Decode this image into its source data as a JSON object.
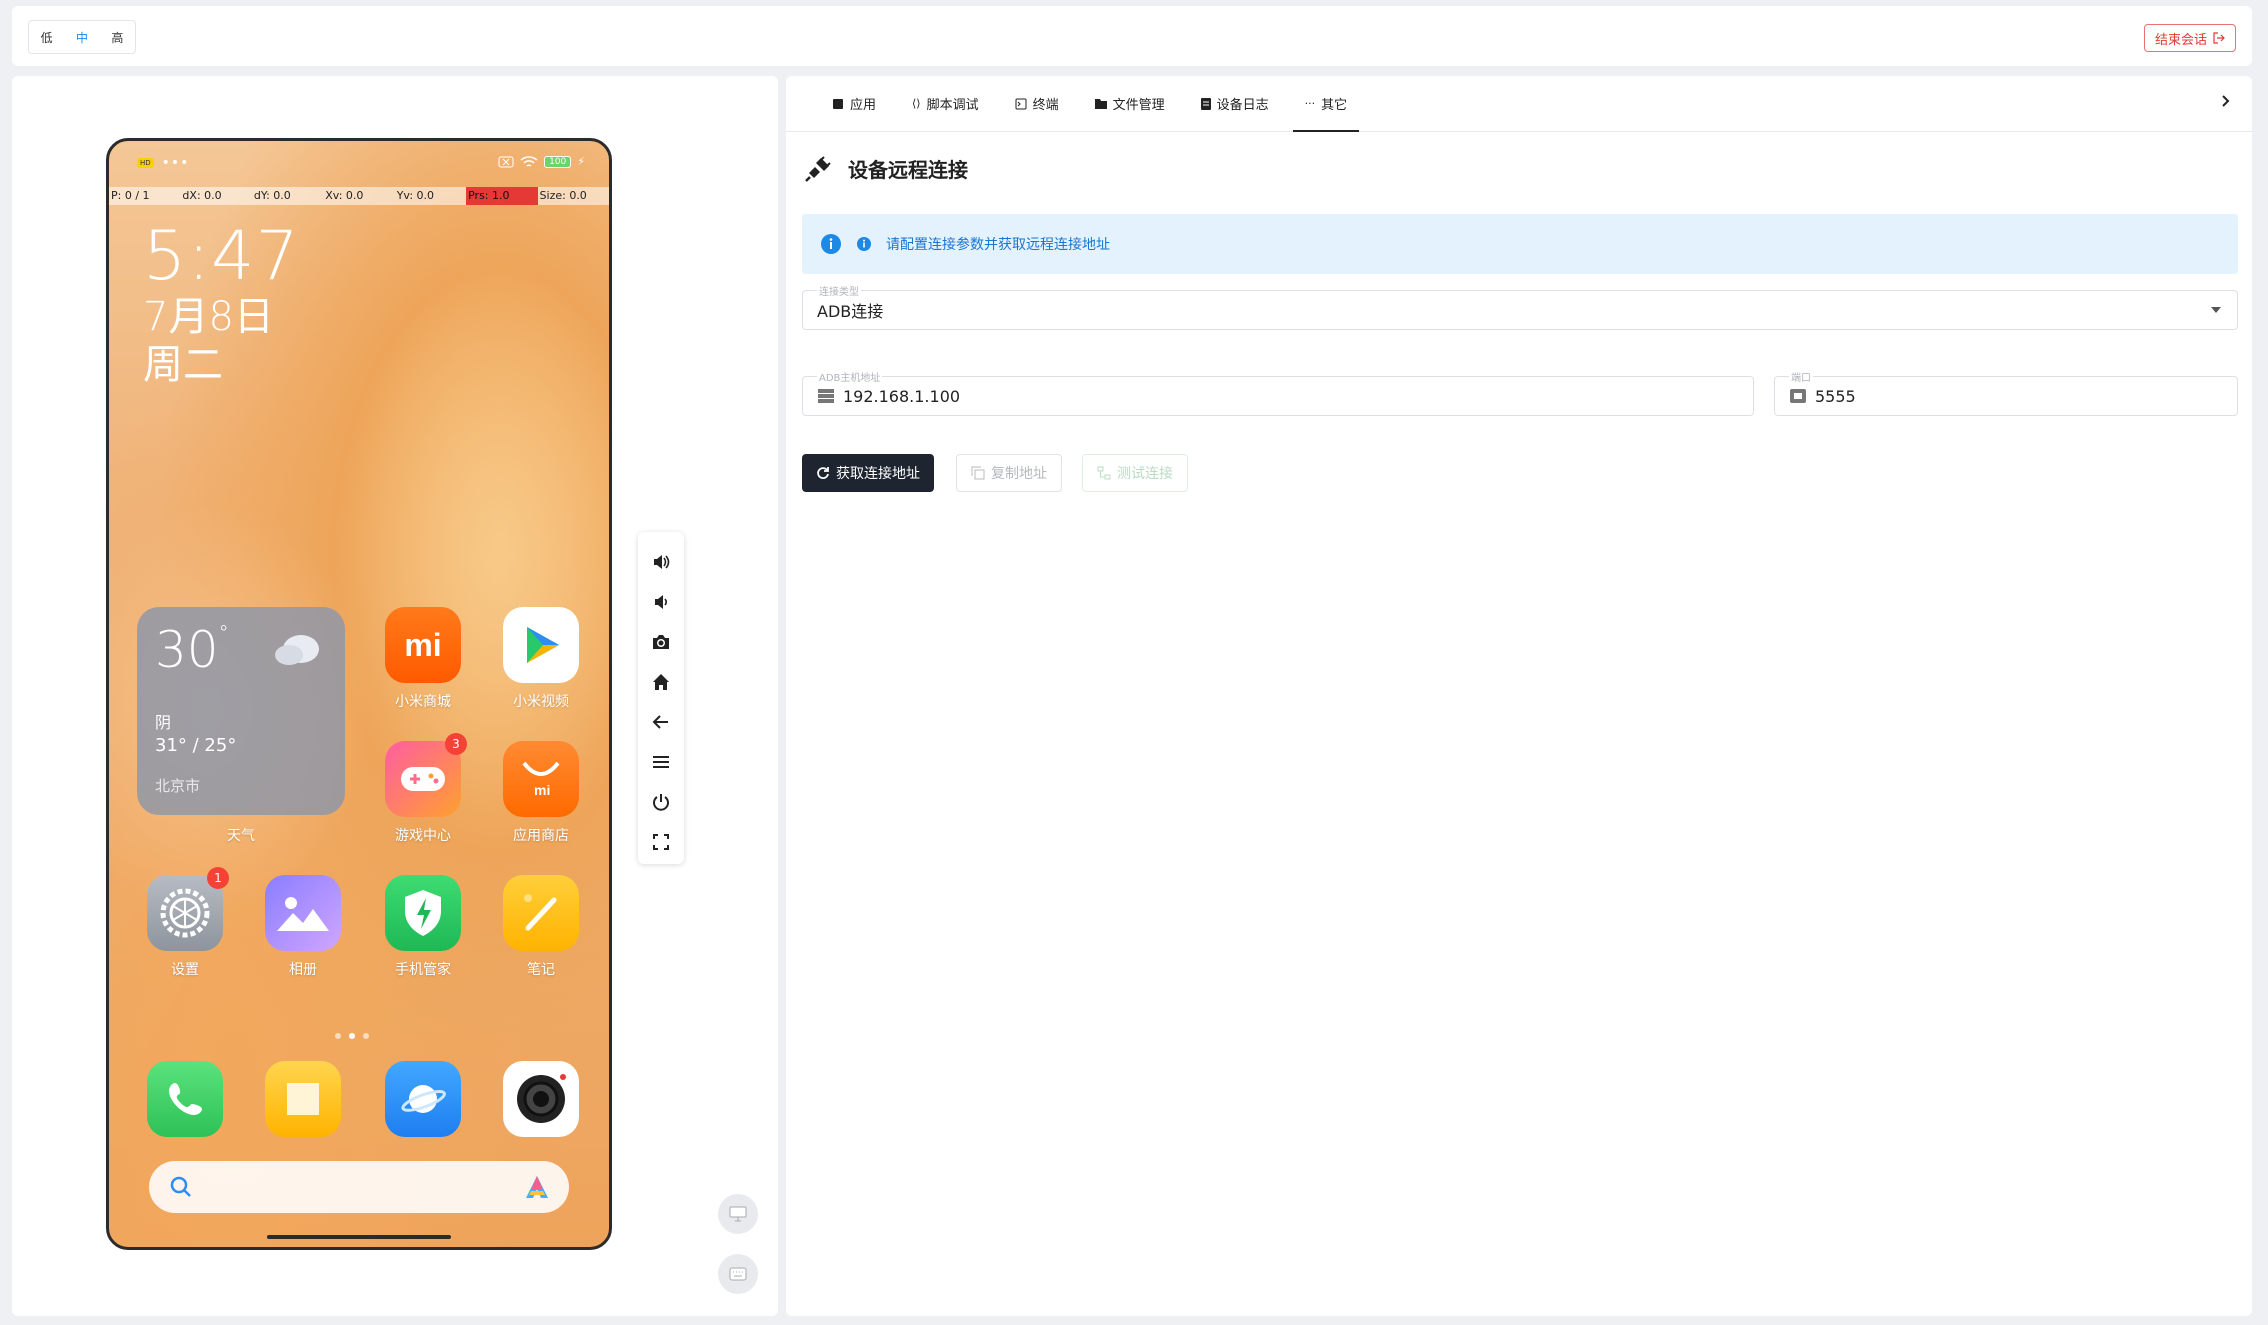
{
  "topbar": {
    "quality_options": [
      "低",
      "中",
      "高"
    ],
    "quality_selected": "中",
    "end_session_label": "结束会话"
  },
  "device": {
    "status_badge": "HD",
    "battery": "100",
    "pointer": {
      "p": "P: 0 / 1",
      "dx": "dX: 0.0",
      "dy": "dY: 0.0",
      "xv": "Xv: 0.0",
      "yv": "Yv: 0.0",
      "prs": "Prs: 1.0",
      "size": "Size: 0.0"
    },
    "clock": {
      "time": "5:47",
      "date": "7月8日",
      "weekday": "周二"
    },
    "weather": {
      "temp": "30",
      "degree": "°",
      "condition": "阴",
      "range": "31° / 25°",
      "city": "北京市",
      "label": "天气"
    },
    "apps": [
      {
        "label": "小米商城",
        "icon": "mi-store-icon"
      },
      {
        "label": "小米视频",
        "icon": "mi-video-icon"
      },
      {
        "label": "游戏中心",
        "icon": "game-center-icon",
        "badge": "3"
      },
      {
        "label": "应用商店",
        "icon": "app-store-icon"
      },
      {
        "label": "设置",
        "icon": "settings-icon",
        "badge": "1"
      },
      {
        "label": "相册",
        "icon": "gallery-icon"
      },
      {
        "label": "手机管家",
        "icon": "security-icon"
      },
      {
        "label": "笔记",
        "icon": "notes-icon"
      }
    ],
    "dock": [
      "phone-icon",
      "messages-icon",
      "browser-icon",
      "camera-icon"
    ]
  },
  "toolbar": [
    "volume-up-icon",
    "volume-down-icon",
    "screenshot-icon",
    "home-icon",
    "back-icon",
    "menu-icon",
    "power-icon",
    "fullscreen-icon"
  ],
  "tabs": [
    {
      "label": "应用",
      "icon": "app-icon"
    },
    {
      "label": "脚本调试",
      "icon": "code-icon"
    },
    {
      "label": "终端",
      "icon": "terminal-icon"
    },
    {
      "label": "文件管理",
      "icon": "folder-icon"
    },
    {
      "label": "设备日志",
      "icon": "log-icon"
    },
    {
      "label": "其它",
      "icon": "more-icon",
      "active": true
    }
  ],
  "remote": {
    "title": "设备远程连接",
    "info": "请配置连接参数并获取远程连接地址",
    "type_label": "连接类型",
    "type_value": "ADB连接",
    "host_label": "ADB主机地址",
    "host_value": "192.168.1.100",
    "port_label": "端口",
    "port_value": "5555",
    "btn_get": "获取连接地址",
    "btn_copy": "复制地址",
    "btn_test": "测试连接"
  },
  "colors": {
    "primary": "#1e88e5",
    "danger": "#e53935",
    "dark_button": "#1f2530",
    "alert_bg": "#e3f2fd"
  }
}
